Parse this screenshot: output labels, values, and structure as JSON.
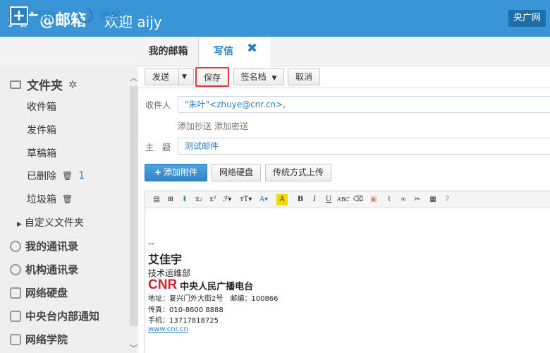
{
  "header": {
    "brand": "央广@邮箱",
    "welcome": "欢迎 aijy",
    "site_link": "央广网"
  },
  "topbar": {
    "compose_label": "写信",
    "refresh_label": "刷新",
    "tabs": [
      {
        "label": "我的邮箱"
      },
      {
        "label": "写信"
      }
    ],
    "close_glyph": "✖"
  },
  "sidebar": {
    "folder_title": "文件夹",
    "items": [
      {
        "label": "收件箱"
      },
      {
        "label": "发件箱"
      },
      {
        "label": "草稿箱"
      },
      {
        "label": "已删除",
        "count": "1"
      },
      {
        "label": "垃圾箱"
      }
    ],
    "custom_folder": "自定义文件夹",
    "sections": [
      {
        "label": "我的通讯录"
      },
      {
        "label": "机构通讯录"
      },
      {
        "label": "网络硬盘"
      },
      {
        "label": "中央台内部通知"
      },
      {
        "label": "网络学院"
      }
    ]
  },
  "compose": {
    "buttons": {
      "send": "发送",
      "save": "保存",
      "signature": "签名档",
      "cancel": "取消"
    },
    "to_label": "收件人",
    "to_value": "\"朱叶\"<zhuye@cnr.cn>,",
    "add_cc": "添加抄送",
    "add_bcc": "添加密送",
    "subject_label": "主　题",
    "subject_value": "测试邮件",
    "attach_label": "添加附件",
    "disk_label": "网络硬盘",
    "upload_label": "传统方式上传"
  },
  "signature": {
    "dashes": "--",
    "name": "艾佳宇",
    "dept": "技术运维部",
    "logo_text": "CNR",
    "org": "中央人民广播电台",
    "address": "地址：复兴门外大街2号　邮编：100866",
    "fax": " 传真：010-8600 8888",
    "mobile": "手机：13717818725",
    "website": "www.cnr.cn"
  },
  "colors": {
    "header_bg": "#3a95d6",
    "accent": "#2c7fc1",
    "save_highlight": "#d93a3a",
    "cnr_red": "#d6202a"
  }
}
